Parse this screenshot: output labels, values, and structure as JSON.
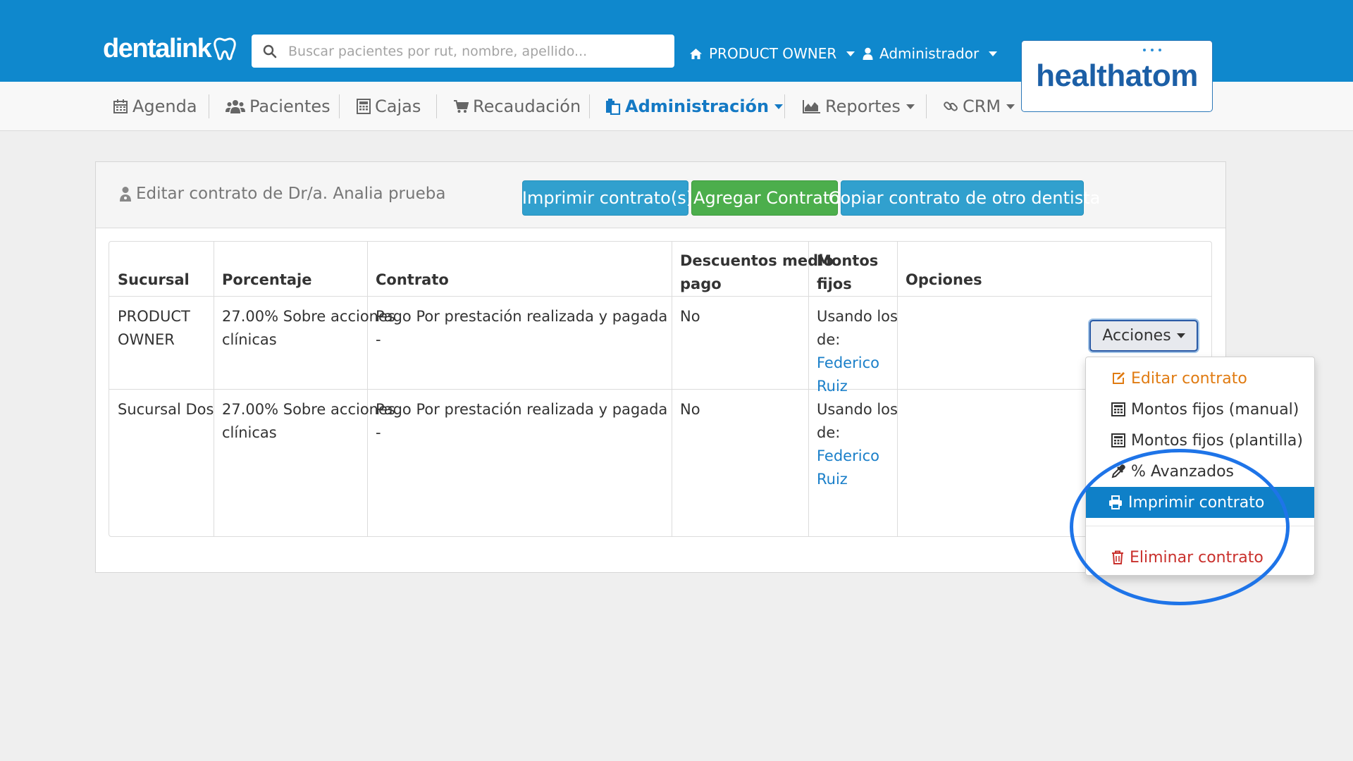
{
  "brand": {
    "logo_text": "dentalink",
    "partner_logo": "healthatom"
  },
  "search": {
    "placeholder": "Buscar pacientes por rut, nombre, apellido..."
  },
  "topnav": {
    "branch": "PRODUCT OWNER",
    "user": "Administrador"
  },
  "mainnav": {
    "items": [
      {
        "label": "Agenda",
        "icon": "calendar-icon"
      },
      {
        "label": "Pacientes",
        "icon": "users-icon"
      },
      {
        "label": "Cajas",
        "icon": "calculator-icon"
      },
      {
        "label": "Recaudación",
        "icon": "cart-icon"
      },
      {
        "label": "Administración",
        "icon": "clipboard-icon",
        "active": true
      },
      {
        "label": "Reportes",
        "icon": "chart-icon"
      },
      {
        "label": "CRM",
        "icon": "link-icon"
      }
    ]
  },
  "panel": {
    "title": "Editar contrato de Dr/a. Analia prueba",
    "buttons": {
      "print": "Imprimir contrato(s)",
      "add": "Agregar Contrato",
      "copy": "Copiar contrato de otro dentista"
    }
  },
  "table": {
    "headers": {
      "sucursal": "Sucursal",
      "porcentaje": "Porcentaje",
      "contrato": "Contrato",
      "descuentos_l1": "Descuentos medio",
      "descuentos_l2": "pago",
      "montos_l1": "Montos",
      "montos_l2": "fijos",
      "opciones": "Opciones"
    },
    "rows": [
      {
        "sucursal_l1": "PRODUCT",
        "sucursal_l2": "OWNER",
        "porcentaje_l1": "27.00% Sobre acciones",
        "porcentaje_l2": "clínicas",
        "contrato_l1": "Pago Por prestación realizada y pagada",
        "contrato_l2": "-",
        "descuentos": "No",
        "montos_l1": "Usando los",
        "montos_l2": "de:",
        "montos_link_l1": "Federico",
        "montos_link_l2": "Ruiz"
      },
      {
        "sucursal_l1": "Sucursal Dos",
        "sucursal_l2": "",
        "porcentaje_l1": "27.00% Sobre acciones",
        "porcentaje_l2": "clínicas",
        "contrato_l1": "Pago Por prestación realizada y pagada",
        "contrato_l2": "-",
        "descuentos": "No",
        "montos_l1": "Usando los",
        "montos_l2": "de:",
        "montos_link_l1": "Federico",
        "montos_link_l2": "Ruiz"
      }
    ],
    "actions_button": "Acciones"
  },
  "dropdown": {
    "items": [
      {
        "label": "Editar contrato",
        "icon": "edit-icon"
      },
      {
        "label": "Montos fijos (manual)",
        "icon": "calculator-icon"
      },
      {
        "label": "Montos fijos (plantilla)",
        "icon": "calculator-icon"
      },
      {
        "label": "% Avanzados",
        "icon": "eyedropper-icon"
      },
      {
        "label": "Imprimir contrato",
        "icon": "print-icon",
        "active": true
      },
      {
        "label": "Eliminar contrato",
        "icon": "trash-icon"
      }
    ]
  },
  "colors": {
    "topbar": "#0f88cd",
    "accent": "#1479c4",
    "info_button": "#31a0ce",
    "success_button": "#4cae4c",
    "active_menu": "#0f80c8",
    "danger": "#c9302c",
    "warning": "#e07b12",
    "highlight_circle": "#1e74e8"
  }
}
